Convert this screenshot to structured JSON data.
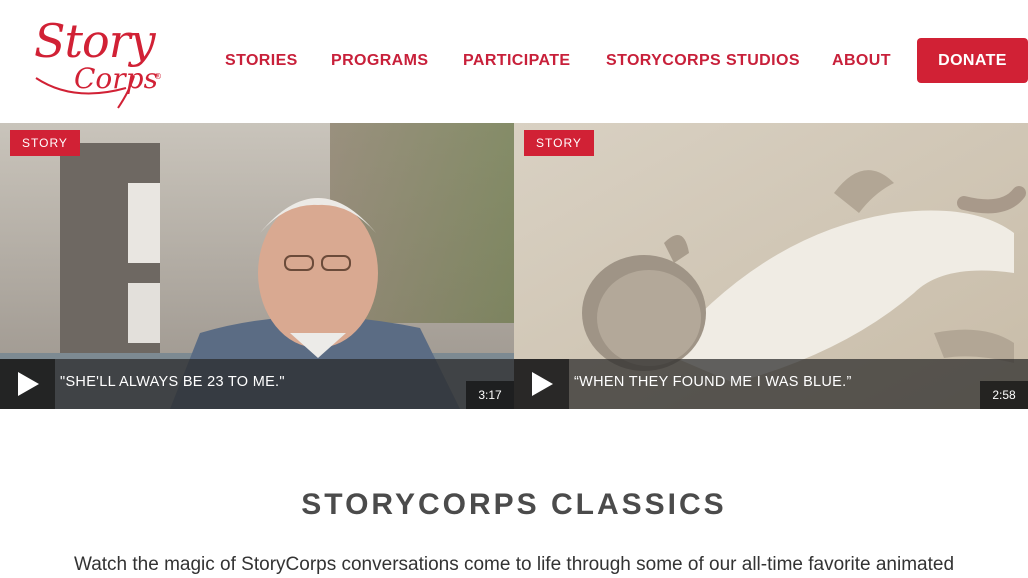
{
  "logo": {
    "line1": "Story",
    "line2": "Corps",
    "reg": "®"
  },
  "nav": {
    "items": [
      {
        "label": "STORIES"
      },
      {
        "label": "PROGRAMS"
      },
      {
        "label": "PARTICIPATE"
      },
      {
        "label": "STORYCORPS STUDIOS"
      },
      {
        "label": "ABOUT"
      }
    ],
    "donate_label": "DONATE"
  },
  "stories": [
    {
      "badge": "STORY",
      "quote": "\"SHE'LL ALWAYS BE 23 TO ME.\"",
      "duration": "3:17"
    },
    {
      "badge": "STORY",
      "quote": "“WHEN THEY FOUND ME I WAS BLUE.”",
      "duration": "2:58"
    }
  ],
  "classics": {
    "title": "STORYCORPS CLASSICS",
    "description": "Watch the magic of StoryCorps conversations come to life through some of our all-time favorite animated"
  },
  "colors": {
    "brand_red": "#d12135",
    "nav_text": "#c8203a",
    "heading_gray": "#4b4b4b"
  },
  "icons": [
    "play-icon"
  ]
}
